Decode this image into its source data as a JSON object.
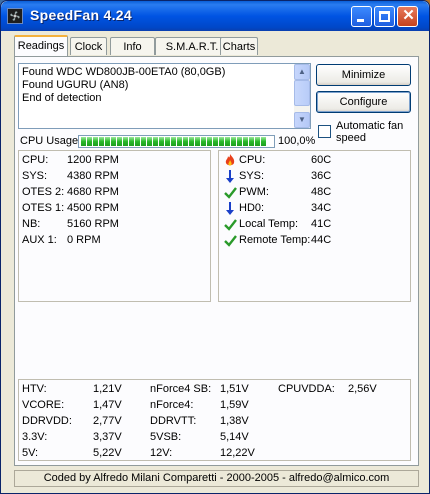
{
  "window": {
    "title": "SpeedFan 4.24"
  },
  "tabs": [
    {
      "label": "Readings",
      "active": true
    },
    {
      "label": "Clock",
      "active": false
    },
    {
      "label": "Info",
      "active": false
    },
    {
      "label": "S.M.A.R.T.",
      "active": false
    },
    {
      "label": "Charts",
      "active": false
    }
  ],
  "log": {
    "lines": [
      "Found WDC WD800JB-00ETA0 (80,0GB)",
      "Found UGURU (AN8)",
      "End of detection"
    ]
  },
  "buttons": {
    "minimize": "Minimize",
    "configure": "Configure"
  },
  "auto_fan": {
    "label": "Automatic fan speed",
    "checked": false
  },
  "cpu_usage": {
    "label": "CPU Usage",
    "percent_text": "100,0%",
    "percent": 100
  },
  "fans": [
    {
      "label": "CPU:",
      "value": "1200 RPM"
    },
    {
      "label": "SYS:",
      "value": "4380 RPM"
    },
    {
      "label": "OTES 2:",
      "value": "4680 RPM"
    },
    {
      "label": "OTES 1:",
      "value": "4500 RPM"
    },
    {
      "label": "NB:",
      "value": "5160 RPM"
    },
    {
      "label": "AUX 1:",
      "value": "0 RPM"
    }
  ],
  "temps": [
    {
      "label": "CPU:",
      "value": "60C",
      "icon": "flame-icon"
    },
    {
      "label": "SYS:",
      "value": "36C",
      "icon": "arrow-down-icon"
    },
    {
      "label": "PWM:",
      "value": "48C",
      "icon": "checkmark-icon"
    },
    {
      "label": "HD0:",
      "value": "34C",
      "icon": "arrow-down-icon"
    },
    {
      "label": "Local Temp:",
      "value": "41C",
      "icon": "checkmark-icon"
    },
    {
      "label": "Remote Temp:",
      "value": "44C",
      "icon": "checkmark-icon"
    }
  ],
  "voltages": {
    "col1": [
      {
        "label": "HTV:",
        "value": "1,21V"
      },
      {
        "label": "VCORE:",
        "value": "1,47V"
      },
      {
        "label": "DDRVDD:",
        "value": "2,77V"
      },
      {
        "label": "3.3V:",
        "value": "3,37V"
      },
      {
        "label": "5V:",
        "value": "5,22V"
      }
    ],
    "col2": [
      {
        "label": "nForce4 SB:",
        "value": "1,51V"
      },
      {
        "label": "nForce4:",
        "value": "1,59V"
      },
      {
        "label": "DDRVTT:",
        "value": "1,38V"
      },
      {
        "label": "5VSB:",
        "value": "5,14V"
      },
      {
        "label": "12V:",
        "value": "12,22V"
      }
    ],
    "col3": [
      {
        "label": "CPUVDDA:",
        "value": "2,56V"
      }
    ]
  },
  "footer": {
    "text": "Coded by Alfredo Milani Comparetti - 2000-2005 - alfredo@almico.com"
  }
}
